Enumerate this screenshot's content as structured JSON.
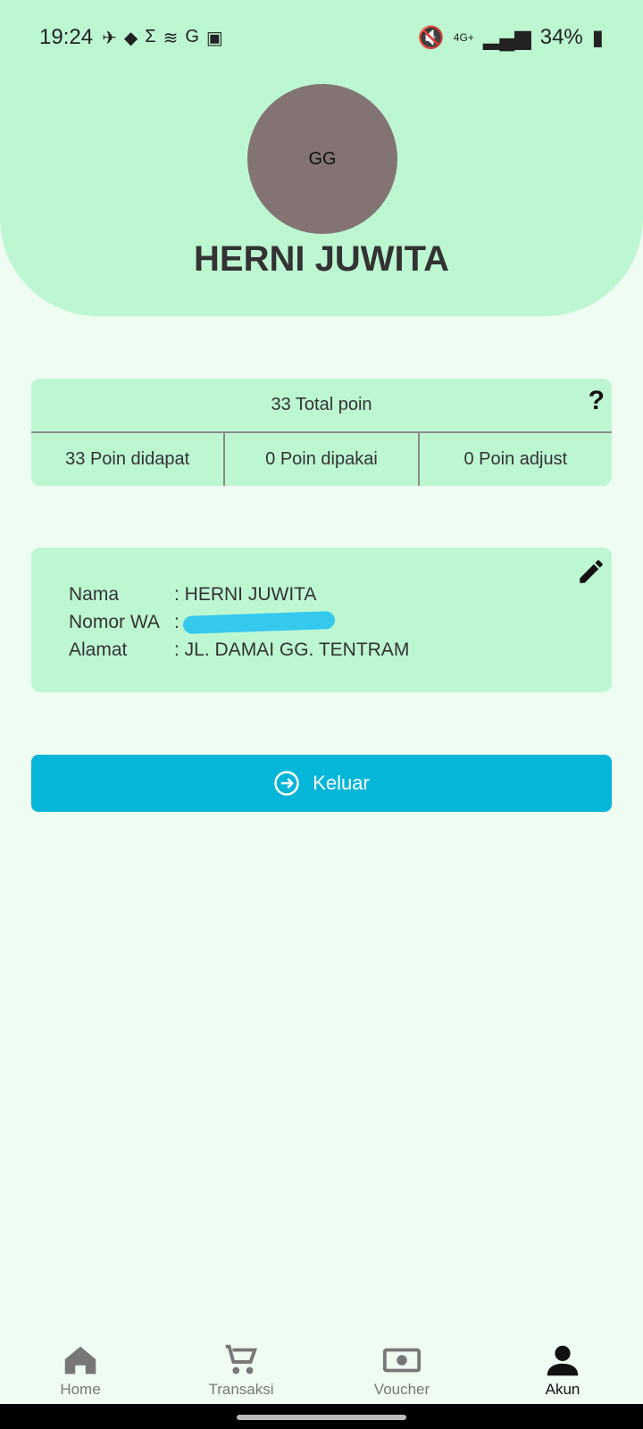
{
  "status_bar": {
    "time": "19:24",
    "battery": "34%",
    "network": "4G+",
    "left_icons": [
      "telegram-icon",
      "pulse-icon",
      "sigma-icon",
      "audio-icon",
      "grammarly-icon",
      "gallery-icon"
    ],
    "right_icons": [
      "mute-icon",
      "signal-icon",
      "battery-icon"
    ]
  },
  "profile": {
    "avatar_initials": "GG",
    "name": "HERNI JUWITA"
  },
  "points": {
    "total": "33 Total poin",
    "earned": "33 Poin didapat",
    "used": "0 Poin dipakai",
    "adjust": "0 Poin adjust",
    "help_label": "?"
  },
  "info": {
    "name_label": "Nama",
    "name_value": ": HERNI JUWITA",
    "wa_label": "Nomor WA",
    "wa_value": ":",
    "address_label": "Alamat",
    "address_value": ": JL. DAMAI GG. TENTRAM"
  },
  "actions": {
    "logout": "Keluar"
  },
  "nav": {
    "items": [
      {
        "label": "Home",
        "icon": "home-icon"
      },
      {
        "label": "Transaksi",
        "icon": "cart-icon"
      },
      {
        "label": "Voucher",
        "icon": "voucher-icon"
      },
      {
        "label": "Akun",
        "icon": "account-icon"
      }
    ]
  },
  "colors": {
    "header": "#bdf7d2",
    "background": "#effcf2",
    "primary_button": "#06b6d8",
    "avatar": "#837373"
  }
}
